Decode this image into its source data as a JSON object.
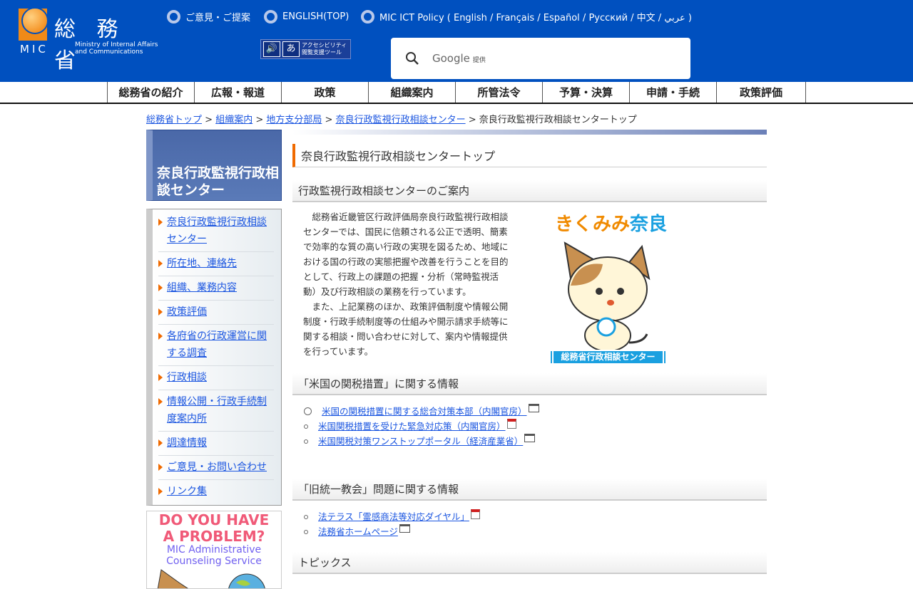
{
  "header": {
    "logo_kanji": "総 務 省",
    "logo_mic": "MIC",
    "logo_en_1": "Ministry of Internal Affairs",
    "logo_en_2": "and Communications",
    "links": [
      "ご意見・ご提案",
      "ENGLISH(TOP)",
      "MIC ICT Policy ( English / Français / Español / Русский / 中文 / عربي )"
    ],
    "accessibility": {
      "line1": "アクセシビリティ",
      "line2": "閲覧支援ツール",
      "icon2": "あ"
    },
    "search": {
      "brand": "Google",
      "suffix": "提供"
    }
  },
  "nav": [
    "総務省の紹介",
    "広報・報道",
    "政策",
    "組織案内",
    "所管法令",
    "予算・決算",
    "申請・手続",
    "政策評価"
  ],
  "breadcrumb": {
    "items": [
      "総務省トップ",
      "組織案内",
      "地方支分部局",
      "奈良行政監視行政相談センター"
    ],
    "current": "奈良行政監視行政相談センタートップ",
    "sep": " > "
  },
  "sidebar": {
    "title": "奈良行政監視行政相談センター",
    "menu": [
      "奈良行政監視行政相談センター",
      "所在地、連絡先",
      "組織、業務内容",
      "政策評価",
      "各府省の行政運営に関する調査",
      "行政相談",
      "情報公開・行政手続制度案内所",
      "調達情報",
      "ご意見・お問い合わせ",
      "リンク集"
    ],
    "banner": {
      "line1": "DO YOU HAVE",
      "line2": "A PROBLEM?",
      "line3": "MIC Administrative",
      "line4": "Counseling Service"
    }
  },
  "main": {
    "title": "奈良行政監視行政相談センタートップ",
    "section1": {
      "heading": "行政監視行政相談センターのご案内",
      "para1": "　総務省近畿管区行政評価局奈良行政監視行政相談センターでは、国民に信頼される公正で透明、簡素で効率的な質の高い行政の実現を図るため、地域における国の行政の実態把握や改善を行うことを目的として、行政上の課題の把握・分析（常時監視活動）及び行政相談の業務を行っています。",
      "para2": "　また、上記業務のほか、政策評価制度や情報公開制度・行政手続制度等の仕組みや開示請求手続等に関する相談・問い合わせに対して、案内や情報提供を行っています。",
      "mascot_title_a": "きくみみ",
      "mascot_title_b": "奈良",
      "mascot_caption": "総務省行政相談センター"
    },
    "section2": {
      "heading": "「米国の関税措置」に関する情報",
      "links": [
        {
          "text": "米国の関税措置に関する総合対策本部（内閣官房）",
          "icon": "external-window-icon"
        },
        {
          "text": "米国関税措置を受けた緊急対応策（内閣官房）",
          "icon": "pdf-icon"
        },
        {
          "text": "米国関税対策ワンストップポータル（経済産業省）",
          "icon": "external-window-icon"
        }
      ]
    },
    "section3": {
      "heading": "「旧統一教会」問題に関する情報",
      "links": [
        {
          "text": "法テラス「霊感商法等対応ダイヤル」",
          "icon": "pdf-icon"
        },
        {
          "text": "法務省ホームページ",
          "icon": "external-window-icon"
        }
      ]
    },
    "section4": {
      "heading": "トピックス"
    }
  }
}
